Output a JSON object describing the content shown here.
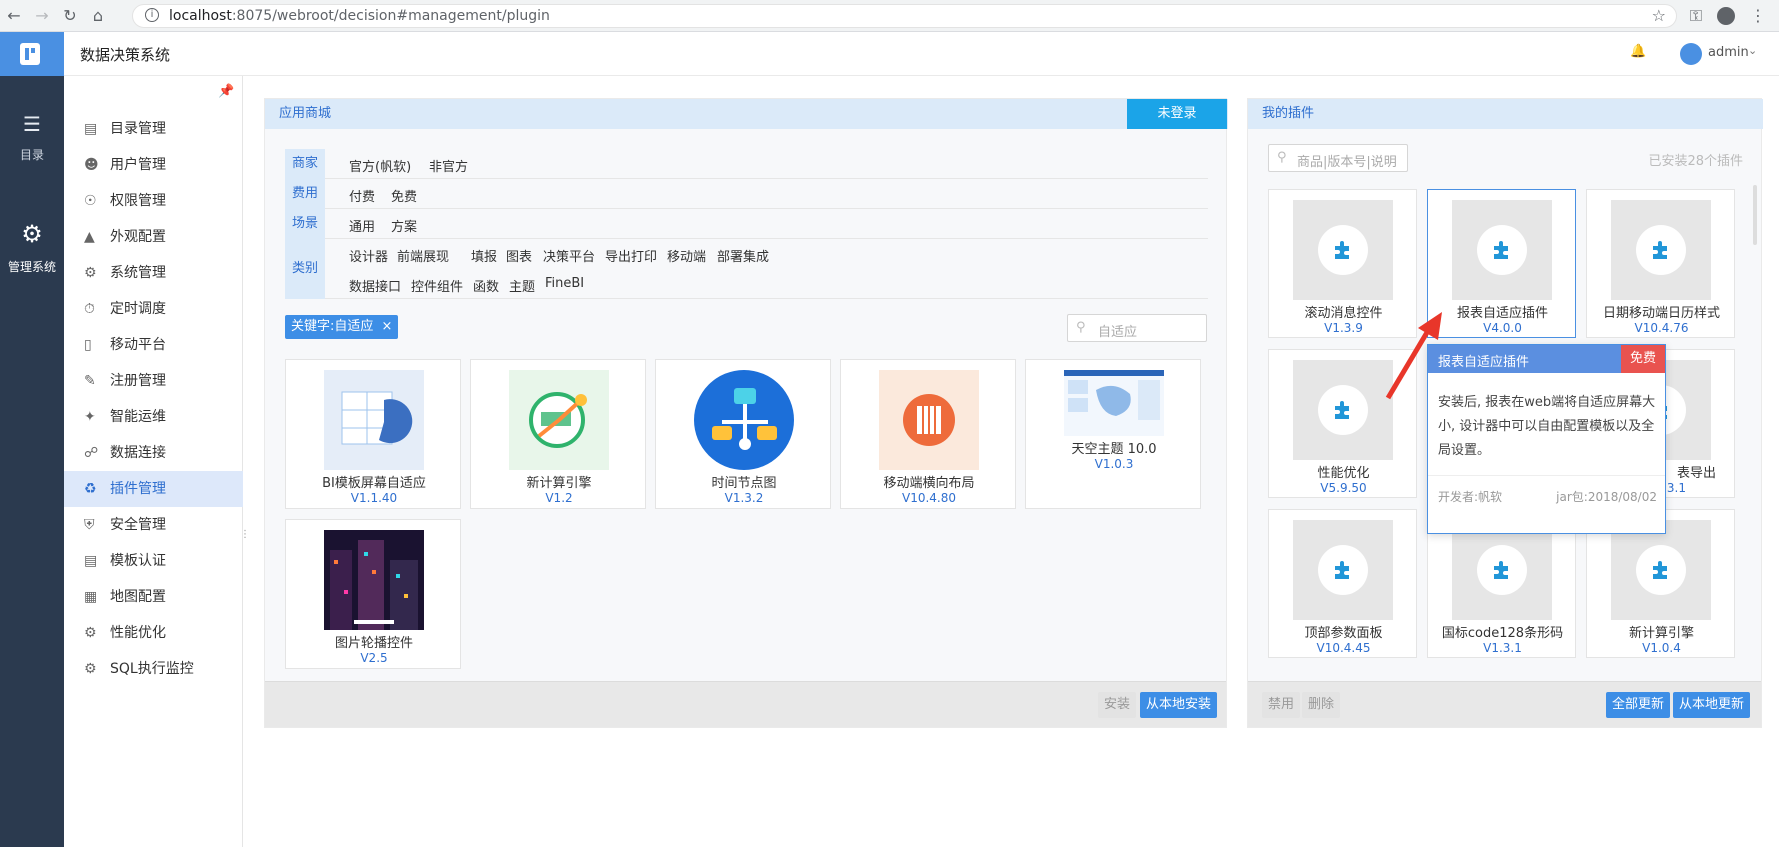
{
  "browser": {
    "url_host": "localhost",
    "url_path": ":8075/webroot/decision#management/plugin"
  },
  "rail": {
    "catalog_label": "目录",
    "manage_label": "管理系统"
  },
  "header": {
    "title": "数据决策系统",
    "user": "admin"
  },
  "sidebar": {
    "items": [
      {
        "label": "目录管理",
        "icon": "catalog-icon"
      },
      {
        "label": "用户管理",
        "icon": "user-icon"
      },
      {
        "label": "权限管理",
        "icon": "lock-icon"
      },
      {
        "label": "外观配置",
        "icon": "appearance-icon"
      },
      {
        "label": "系统管理",
        "icon": "system-icon"
      },
      {
        "label": "定时调度",
        "icon": "timer-icon"
      },
      {
        "label": "移动平台",
        "icon": "mobile-icon"
      },
      {
        "label": "注册管理",
        "icon": "register-icon"
      },
      {
        "label": "智能运维",
        "icon": "ops-icon"
      },
      {
        "label": "数据连接",
        "icon": "link-icon"
      },
      {
        "label": "插件管理",
        "icon": "plugin-icon"
      },
      {
        "label": "安全管理",
        "icon": "shield-icon"
      },
      {
        "label": "模板认证",
        "icon": "template-icon"
      },
      {
        "label": "地图配置",
        "icon": "map-icon"
      },
      {
        "label": "性能优化",
        "icon": "performance-icon"
      },
      {
        "label": "SQL执行监控",
        "icon": "monitor-icon"
      }
    ]
  },
  "store": {
    "title": "应用商城",
    "login_button": "未登录",
    "filters": {
      "merchant_label": "商家",
      "merchant_options": [
        "官方(帆软)",
        "非官方"
      ],
      "cost_label": "费用",
      "cost_options": [
        "付费",
        "免费"
      ],
      "scene_label": "场景",
      "scene_options": [
        "通用",
        "方案"
      ],
      "category_label": "类别",
      "category_row1": [
        "设计器",
        "前端展现",
        "填报",
        "图表",
        "决策平台",
        "导出打印",
        "移动端",
        "部署集成"
      ],
      "category_row2": [
        "数据接口",
        "控件组件",
        "函数",
        "主题",
        "FineBI"
      ]
    },
    "keyword_tag": "关键字:自适应",
    "search_placeholder": "自适应",
    "cards": [
      {
        "name": "BI模板屏幕自适应",
        "version": "V1.1.40"
      },
      {
        "name": "新计算引擎",
        "version": "V1.2"
      },
      {
        "name": "时间节点图",
        "version": "V1.3.2"
      },
      {
        "name": "移动端横向布局",
        "version": "V10.4.80"
      },
      {
        "name": "天空主题 10.0",
        "version": "V1.0.3"
      },
      {
        "name": "图片轮播控件",
        "version": "V2.5"
      }
    ],
    "install_button": "安装",
    "local_install_button": "从本地安装"
  },
  "myplugins": {
    "title": "我的插件",
    "search_placeholder": "商品|版本号|说明",
    "installed_count": "已安装28个插件",
    "cards": [
      {
        "name": "滚动消息控件",
        "version": "V1.3.9"
      },
      {
        "name": "报表自适应插件",
        "version": "V4.0.0"
      },
      {
        "name": "日期移动端日历样式",
        "version": "V10.4.76"
      },
      {
        "name": "性能优化",
        "version": "V5.9.50"
      },
      {
        "name": "表导出",
        "version": "3.1"
      },
      {
        "name": "顶部参数面板",
        "version": "V10.4.45"
      },
      {
        "name": "国标code128条形码",
        "version": "V1.3.1"
      },
      {
        "name": "新计算引擎",
        "version": "V1.0.4"
      }
    ],
    "disable_button": "禁用",
    "delete_button": "删除",
    "update_all_button": "全部更新",
    "local_update_button": "从本地更新"
  },
  "tooltip": {
    "title": "报表自适应插件",
    "badge": "免费",
    "description": "安装后, 报表在web端将自适应屏幕大小, 设计器中可以自由配置模板以及全局设置。",
    "developer": "开发者:帆软",
    "jar": "jar包:2018/08/02"
  },
  "colors": {
    "accent": "#3d8ee6",
    "rail": "#2b3a4f",
    "header_bg": "#dbeaf9",
    "badge_red": "#e9534f"
  }
}
